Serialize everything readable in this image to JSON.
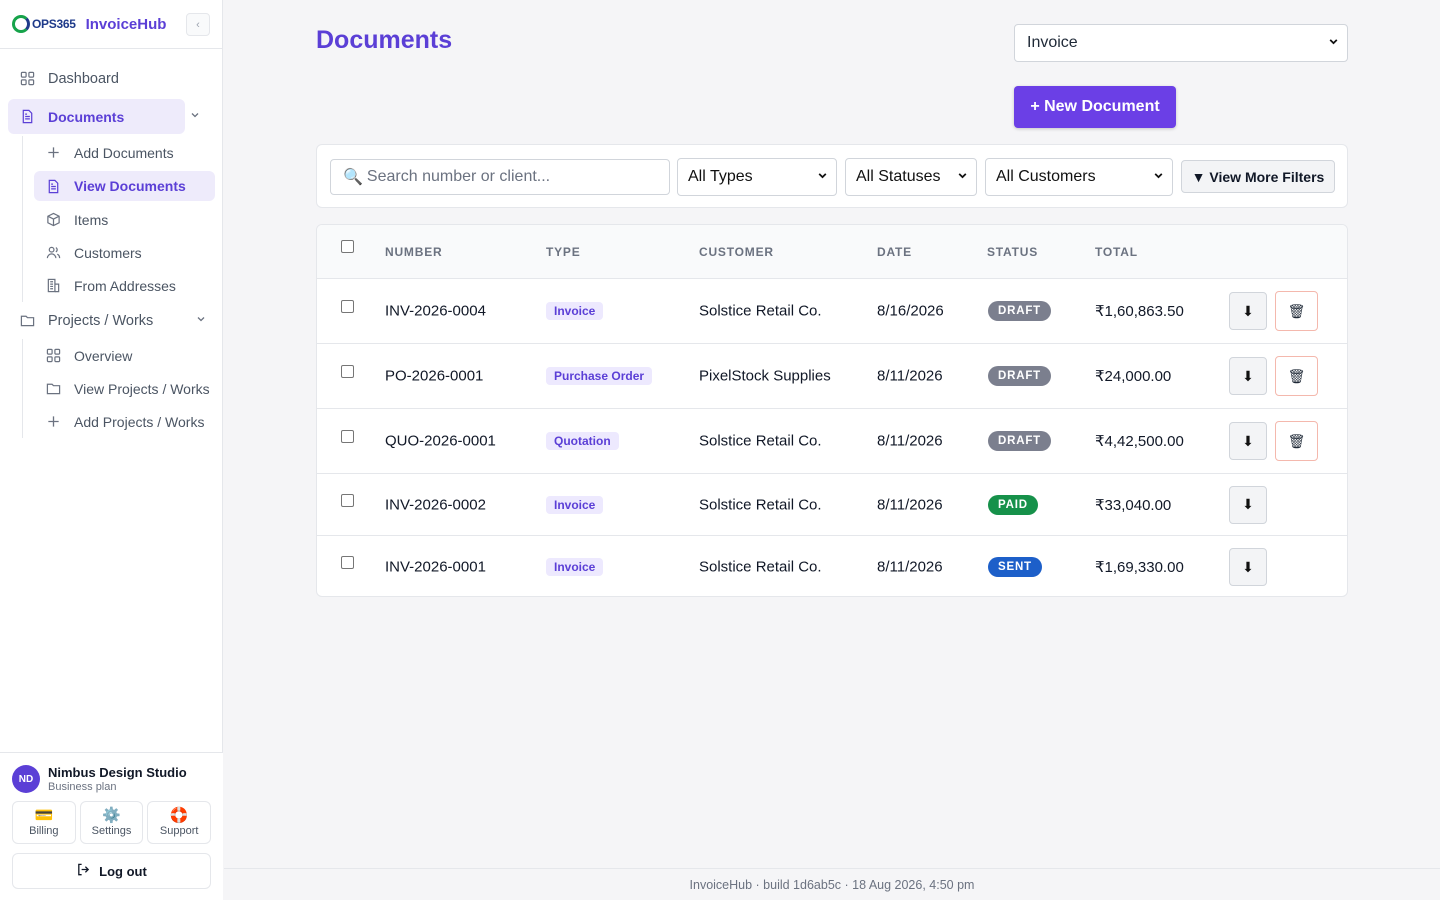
{
  "brand": {
    "logo_text": "OPS365",
    "app_name": "InvoiceHub",
    "collapse_glyph": "‹"
  },
  "nav": {
    "dashboard": "Dashboard",
    "documents": "Documents",
    "documents_sub": [
      "Add Documents",
      "View Documents",
      "Items",
      "Customers",
      "From Addresses"
    ],
    "projects": "Projects / Works",
    "projects_sub": [
      "Overview",
      "View Projects / Works",
      "Add Projects / Works"
    ]
  },
  "account": {
    "initials": "ND",
    "name": "Nimbus Design Studio",
    "plan": "Business plan",
    "billing": "Billing",
    "settings": "Settings",
    "support": "Support",
    "logout": "Log out"
  },
  "header": {
    "title": "Documents",
    "doc_type_value": "Invoice",
    "new_doc_label": "+ New Document"
  },
  "filters": {
    "search_placeholder": "Search number or client...",
    "types": "All Types",
    "statuses": "All Statuses",
    "customers": "All Customers",
    "more": "▼ View More Filters"
  },
  "table": {
    "headers": {
      "number": "NUMBER",
      "type": "TYPE",
      "customer": "CUSTOMER",
      "date": "DATE",
      "status": "STATUS",
      "total": "TOTAL"
    },
    "rows": [
      {
        "number": "INV-2026-0004",
        "type": "Invoice",
        "customer": "Solstice Retail Co.",
        "date": "8/16/2026",
        "status": "DRAFT",
        "status_color": "#7b7f8e",
        "total": "₹1,60,863.50",
        "deletable": true
      },
      {
        "number": "PO-2026-0001",
        "type": "Purchase Order",
        "customer": "PixelStock Supplies",
        "date": "8/11/2026",
        "status": "DRAFT",
        "status_color": "#7b7f8e",
        "total": "₹24,000.00",
        "deletable": true
      },
      {
        "number": "QUO-2026-0001",
        "type": "Quotation",
        "customer": "Solstice Retail Co.",
        "date": "8/11/2026",
        "status": "DRAFT",
        "status_color": "#7b7f8e",
        "total": "₹4,42,500.00",
        "deletable": true
      },
      {
        "number": "INV-2026-0002",
        "type": "Invoice",
        "customer": "Solstice Retail Co.",
        "date": "8/11/2026",
        "status": "PAID",
        "status_color": "#16914a",
        "total": "₹33,040.00",
        "deletable": false
      },
      {
        "number": "INV-2026-0001",
        "type": "Invoice",
        "customer": "Solstice Retail Co.",
        "date": "8/11/2026",
        "status": "SENT",
        "status_color": "#1d5fc9",
        "total": "₹1,69,330.00",
        "deletable": false
      }
    ]
  },
  "footer": "InvoiceHub · build 1d6ab5c · 18 Aug 2026, 4:50 pm",
  "colors": {
    "accent": "#5b3fd6",
    "primary_button": "#6b3fe6",
    "draft": "#7b7f8e",
    "paid": "#16914a",
    "sent": "#1d5fc9"
  }
}
